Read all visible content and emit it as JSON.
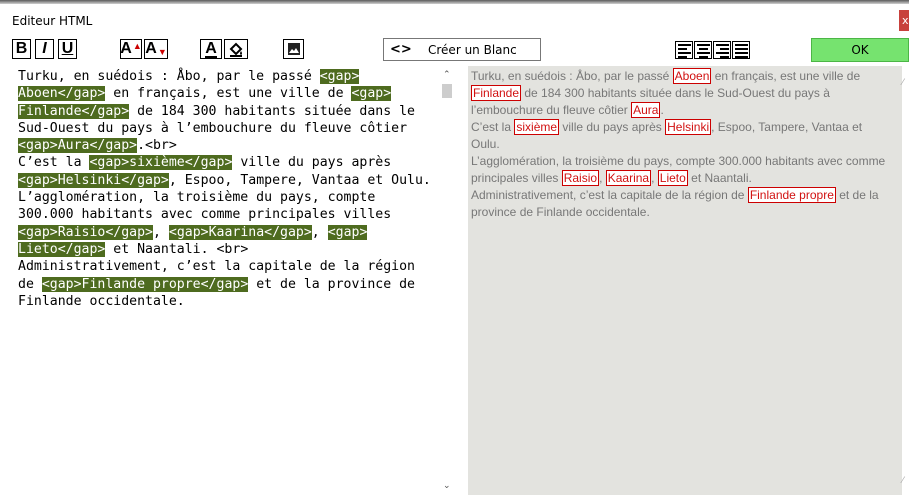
{
  "window": {
    "title": "Editeur HTML",
    "close_glyph": "x"
  },
  "toolbar": {
    "bold": "B",
    "italic": "I",
    "underline": "U",
    "font_up": "A",
    "font_down": "A",
    "text_color": "A",
    "fill_icon": "paint-bucket-icon",
    "image_icon": "image-icon",
    "blank_arrows": "<>",
    "blank_label": "Créer un Blanc",
    "ok_label": "OK",
    "accent_color": "#76e36f"
  },
  "editor": {
    "segments": [
      {
        "t": "Turku, en suédois : Åbo, par le passé ",
        "g": false
      },
      {
        "t": "<gap>\nAboen</gap>",
        "g": true
      },
      {
        "t": " en français, est une ville de ",
        "g": false
      },
      {
        "t": "<gap>\nFinlande</gap>",
        "g": true
      },
      {
        "t": " de 184 300 habitants située dans le\nSud-Ouest du pays à l’embouchure du fleuve côtier\n",
        "g": false
      },
      {
        "t": "<gap>Aura</gap>",
        "g": true
      },
      {
        "t": ".<br>\nC’est la ",
        "g": false
      },
      {
        "t": "<gap>sixième</gap>",
        "g": true
      },
      {
        "t": " ville du pays après\n",
        "g": false
      },
      {
        "t": "<gap>Helsinki</gap>",
        "g": true
      },
      {
        "t": ", Espoo, Tampere, Vantaa et Oulu.\nL’agglomération, la troisième du pays, compte\n300.000 habitants avec comme principales villes\n",
        "g": false
      },
      {
        "t": "<gap>Raisio</gap>",
        "g": true
      },
      {
        "t": ", ",
        "g": false
      },
      {
        "t": "<gap>Kaarina</gap>",
        "g": true
      },
      {
        "t": ", ",
        "g": false
      },
      {
        "t": "<gap>\nLieto</gap>",
        "g": true
      },
      {
        "t": " et Naantali. <br>\nAdministrativement, c’est la capitale de la région\nde ",
        "g": false
      },
      {
        "t": "<gap>Finlande propre</gap>",
        "g": true
      },
      {
        "t": " et de la province de\nFinlande occidentale.",
        "g": false
      }
    ],
    "highlight_color": "#4e6b1f"
  },
  "preview": {
    "segments": [
      {
        "t": "Turku, en suédois : Åbo, par le passé ",
        "g": false
      },
      {
        "t": "Aboen",
        "g": true
      },
      {
        "t": " en français, est une ville de\n",
        "g": false
      },
      {
        "t": "Finlande",
        "g": true
      },
      {
        "t": " de 184 300 habitants située dans le Sud-Ouest du pays à\nl’embouchure du fleuve côtier ",
        "g": false
      },
      {
        "t": "Aura",
        "g": true
      },
      {
        "t": ".\nC’est la ",
        "g": false
      },
      {
        "t": "sixième",
        "g": true
      },
      {
        "t": " ville du pays après ",
        "g": false
      },
      {
        "t": "Helsinki",
        "g": true
      },
      {
        "t": ", Espoo, Tampere, Vantaa et Oulu.\nL’agglomération, la troisième du pays, compte 300.000 habitants avec comme\nprincipales villes ",
        "g": false
      },
      {
        "t": "Raisio",
        "g": true
      },
      {
        "t": ", ",
        "g": false
      },
      {
        "t": "Kaarina",
        "g": true
      },
      {
        "t": ", ",
        "g": false
      },
      {
        "t": "Lieto",
        "g": true
      },
      {
        "t": " et Naantali.\nAdministrativement, c’est la capitale de la région de ",
        "g": false
      },
      {
        "t": "Finlande propre",
        "g": true
      },
      {
        "t": " et de la\nprovince de Finlande occidentale.",
        "g": false
      }
    ],
    "gap_color": "#d11111"
  }
}
